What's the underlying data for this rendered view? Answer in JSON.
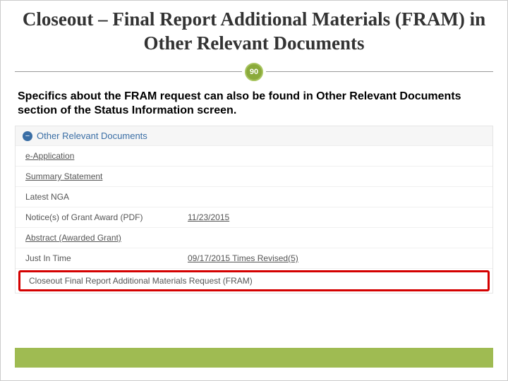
{
  "title": "Closeout – Final Report Additional Materials (FRAM)  in Other Relevant Documents",
  "badge": "90",
  "lead": "Specifics about the FRAM request can also be found in Other Relevant Documents section of the Status Information screen.",
  "panel": {
    "header": "Other Relevant Documents",
    "collapse_glyph": "−",
    "rows": [
      {
        "label": "e-Application",
        "value": "",
        "label_link": true
      },
      {
        "label": "Summary Statement",
        "value": "",
        "label_link": true
      },
      {
        "label": "Latest NGA",
        "value": "",
        "label_link": false
      },
      {
        "label": "Notice(s) of Grant Award (PDF)",
        "value": "11/23/2015",
        "label_link": false,
        "value_link": true
      },
      {
        "label": "Abstract (Awarded Grant)",
        "value": "",
        "label_link": true
      },
      {
        "label": "Just In Time",
        "value": "09/17/2015 Times Revised(5)",
        "label_link": false,
        "value_link": true
      }
    ],
    "highlight": {
      "label": "Closeout Final Report Additional Materials Request (FRAM)"
    }
  }
}
